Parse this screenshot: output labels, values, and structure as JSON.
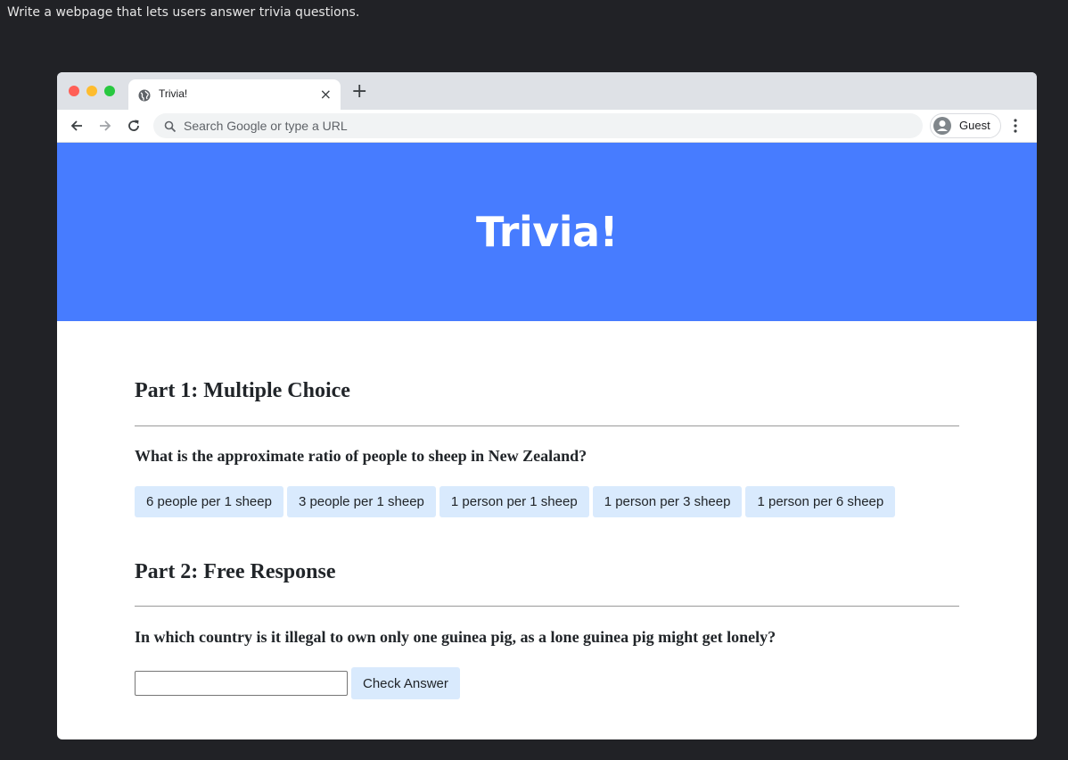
{
  "prompt": "Write a webpage that lets users answer trivia questions.",
  "browser": {
    "tab_title": "Trivia!",
    "tab_close": "×",
    "new_tab": "+",
    "address_placeholder": "Search Google or type a URL",
    "profile_name": "Guest"
  },
  "page": {
    "heading": "Trivia!",
    "part1": {
      "title": "Part 1: Multiple Choice",
      "question": "What is the approximate ratio of people to sheep in New Zealand?",
      "options": [
        "6 people per 1 sheep",
        "3 people per 1 sheep",
        "1 person per 1 sheep",
        "1 person per 3 sheep",
        "1 person per 6 sheep"
      ]
    },
    "part2": {
      "title": "Part 2: Free Response",
      "question": "In which country is it illegal to own only one guinea pig, as a lone guinea pig might get lonely?",
      "answer_value": "",
      "check_label": "Check Answer"
    }
  },
  "colors": {
    "hero": "#477cff",
    "option_bg": "#d9eafd",
    "desktop_bg": "#212226"
  }
}
